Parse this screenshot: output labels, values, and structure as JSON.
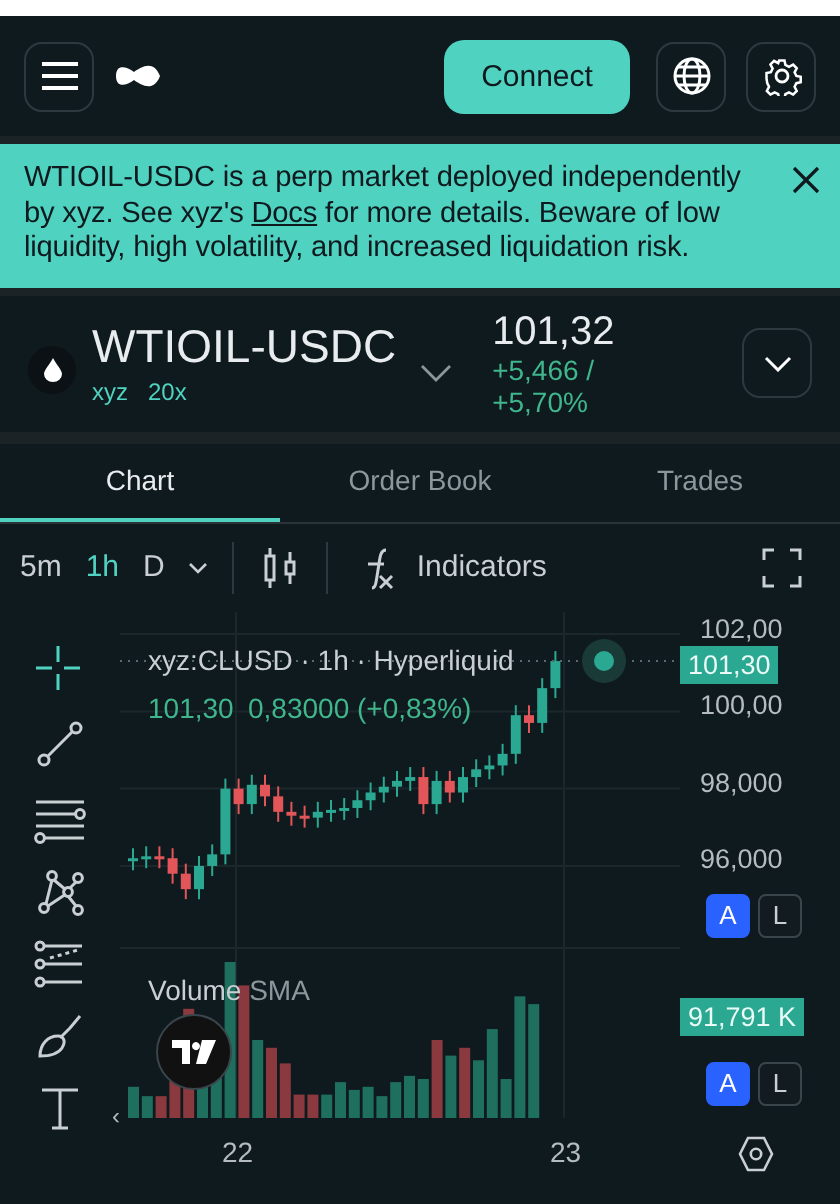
{
  "header": {
    "connect_button": "Connect"
  },
  "banner": {
    "text_before": "WTIOIL-USDC is a perp market deployed independently by xyz. See xyz's ",
    "link": "Docs",
    "text_after": " for more details. Beware of low liquidity, high volatility, and increased liquidation risk."
  },
  "market": {
    "symbol": "WTIOIL-USDC",
    "deployer": "xyz",
    "leverage": "20x",
    "price": "101,32",
    "change": "+5,466 / +5,70%"
  },
  "tabs": [
    {
      "label": "Chart",
      "selected": true
    },
    {
      "label": "Order Book",
      "selected": false
    },
    {
      "label": "Trades",
      "selected": false
    }
  ],
  "toolbar": {
    "intervals": [
      {
        "label": "5m",
        "selected": false
      },
      {
        "label": "1h",
        "selected": true
      },
      {
        "label": "D",
        "selected": false
      }
    ],
    "indicators": "Indicators"
  },
  "chart": {
    "legend_title": "xyz:CLUSD · 1h · Hyperliquid",
    "legend_price": "101,30",
    "legend_change": "0,83000 (+0,83%)",
    "price_ticks": [
      "102,00",
      "100,00",
      "98,000",
      "96,000"
    ],
    "last_price": "101,30",
    "volume_label": "Volume",
    "volume_sma": "SMA",
    "volume_value": "91,791 K",
    "date_ticks": [
      "22",
      "23"
    ],
    "collapse": "‹",
    "price_scale": [
      {
        "label": "A",
        "selected": true
      },
      {
        "label": "L",
        "selected": false
      }
    ],
    "volume_scale": [
      {
        "label": "A",
        "selected": true
      },
      {
        "label": "L",
        "selected": false
      }
    ]
  }
}
